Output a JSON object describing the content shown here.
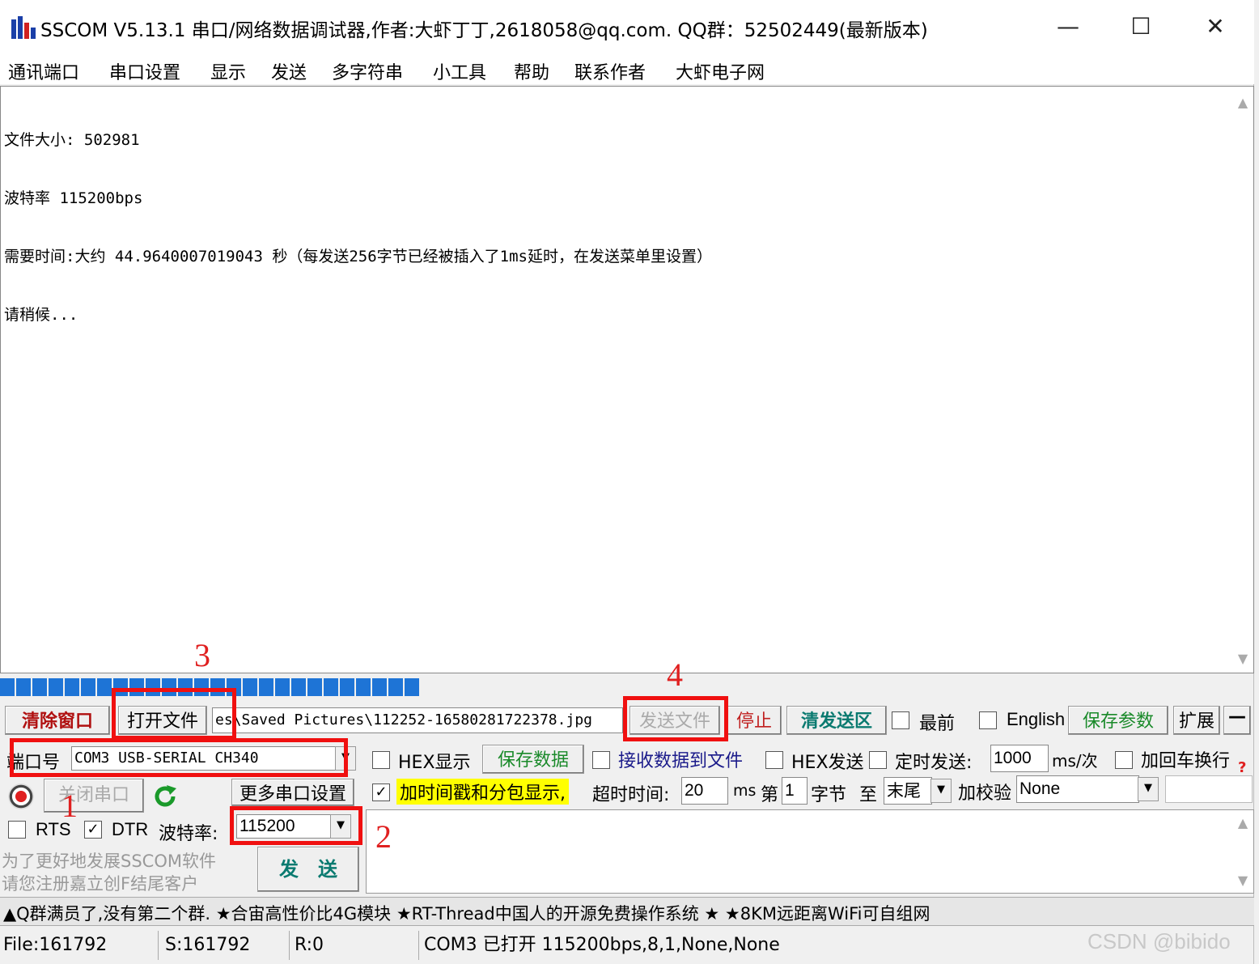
{
  "window": {
    "title": "SSCOM V5.13.1 串口/网络数据调试器,作者:大虾丁丁,2618058@qq.com. QQ群：52502449(最新版本)",
    "minimize": "—",
    "maximize": "☐",
    "close": "✕"
  },
  "menu": [
    "通讯端口",
    "串口设置",
    "显示",
    "发送",
    "多字符串",
    "小工具",
    "帮助",
    "联系作者",
    "大虾电子网"
  ],
  "receive": {
    "lines": [
      "文件大小: 502981",
      "波特率 115200bps",
      "需要时间:大约 44.9640007019043 秒（每发送256字节已经被插入了1ms延时，在发送菜单里设置）",
      "请稍候..."
    ]
  },
  "progress": {
    "fraction": 0.33,
    "segments": 26
  },
  "toolbar": {
    "clear_window": "清除窗口",
    "open_file": "打开文件",
    "file_path": "es\\Saved Pictures\\112252-16580281722378.jpg",
    "send_file": "发送文件",
    "stop": "停止",
    "clear_send": "清发送区",
    "topmost": "最前",
    "english": "English",
    "save_params": "保存参数",
    "expand": "扩展",
    "collapse": "—"
  },
  "port": {
    "label": "端口号",
    "value": "COM3 USB-SERIAL CH340",
    "close_port": "关闭串口",
    "more_settings": "更多串口设置",
    "rts": "RTS",
    "dtr": "DTR",
    "baud_label": "波特率:",
    "baud_value": "115200",
    "promo1": "为了更好地发展SSCOM软件",
    "promo2": "请您注册嘉立创F结尾客户",
    "send": "发　送"
  },
  "options": {
    "hex_display": "HEX显示",
    "save_data": "保存数据",
    "recv_to_file": "接收数据到文件",
    "hex_send": "HEX发送",
    "timed_send": "定时发送:",
    "interval": "1000",
    "interval_unit": "ms/次",
    "add_crlf": "加回车换行",
    "timestamp": "加时间戳和分包显示,",
    "timeout_label": "超时时间:",
    "timeout": "20",
    "ms": "ms",
    "di": "第",
    "byte_index": "1",
    "byte": "字节",
    "to": "至",
    "end": "末尾",
    "checksum_label": "加校验",
    "checksum": "None",
    "help": "?"
  },
  "annotations": [
    "1",
    "2",
    "3",
    "4"
  ],
  "marquee": "▲Q群满员了,没有第二个群. ★合宙高性价比4G模块 ★RT-Thread中国人的开源免费操作系统 ★ ★8KM远距离WiFi可自组网",
  "status": {
    "file": "File:161792",
    "sent": "S:161792",
    "recv": "R:0",
    "port": "COM3 已打开  115200bps,8,1,None,None",
    "watermark": "CSDN @bibido"
  },
  "colors": {
    "accent_red": "#f01010",
    "progress_blue": "#1e74d6",
    "green_text": "#1a8a2a",
    "timestamp_bg": "#ffff00"
  }
}
